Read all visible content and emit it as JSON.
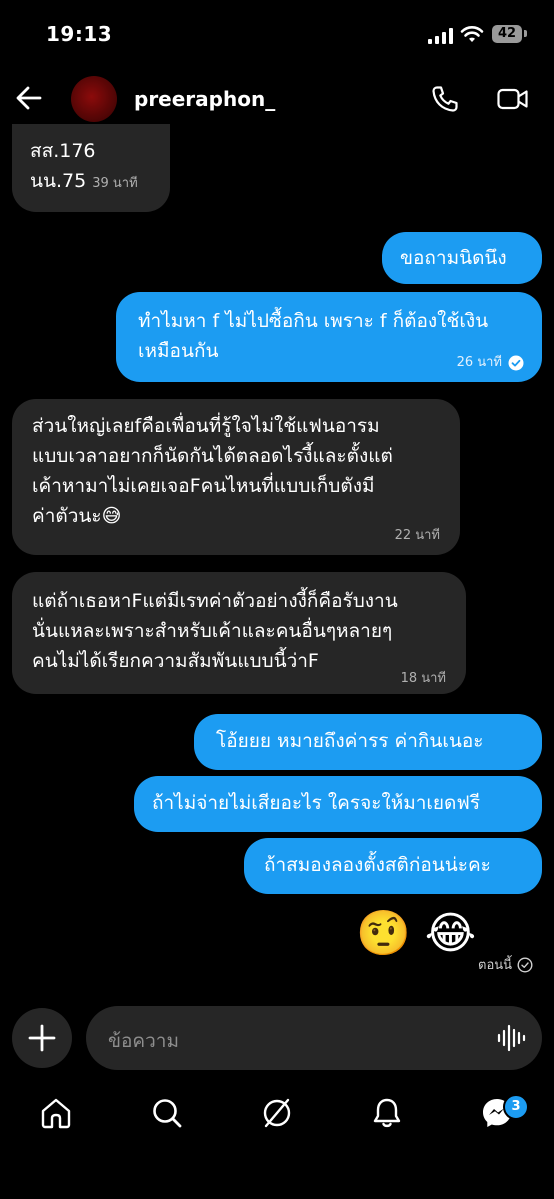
{
  "status_bar": {
    "time": "19:13",
    "battery": "42"
  },
  "header": {
    "username": "preeraphon_"
  },
  "messages": {
    "m0": {
      "line1": "สส.176",
      "line2": "นน.75",
      "time": "39 นาที"
    },
    "m1": {
      "text": "ขอถามนิดนึง"
    },
    "m2": {
      "line1": "ทำไมหา f ไม่ไปซื้อกิน เพราะ f ก็ต้องใช้เงิน",
      "line2": "เหมือนกัน",
      "time": "26 นาที"
    },
    "m3": {
      "line1": "ส่วนใหญ่เลยfคือเพื่อนที่รู้ใจไม่ใช้แฟนอารม",
      "line2": "แบบเวลาอยากก็นัดกันได้ตลอดไรงี้และตั้งแต่",
      "line3": "เค้าหามาไม่เคยเจอFคนไหนที่แบบเก็บตังมี",
      "line4": "ค่าตัวนะ😅",
      "time": "22 นาที"
    },
    "m4": {
      "line1": "แต่ถ้าเธอหาFแต่มีเรทค่าตัวอย่างงี้ก็คือรับงาน",
      "line2": "นั่นแหละเพราะสำหรับเค้าและคนอื่นๆหลายๆ",
      "line3": "คนไม่ได้เรียกความสัมพันแบบนี้ว่าF",
      "time": "18 นาที"
    },
    "m5": {
      "text": "โอ้ยยย  หมายถึงค่ารร ค่ากินเนอะ"
    },
    "m6": {
      "text": "ถ้าไม่จ่ายไม่เสียอะไร ใครจะให้มาเยดฟรี"
    },
    "m7": {
      "text": "ถ้าสมองลองตั้งสติก่อนน่ะคะ"
    },
    "m8": {
      "emoji": "🤨 😂",
      "status": "ตอนนี้"
    }
  },
  "composer": {
    "placeholder": "ข้อความ"
  },
  "nav": {
    "badge": "3"
  },
  "colors": {
    "outgoing": "#1c9cf2",
    "incoming": "#262626",
    "background": "#000000"
  },
  "icons": [
    "back-arrow-icon",
    "phone-icon",
    "video-icon",
    "plus-icon",
    "voice-wave-icon",
    "home-icon",
    "search-icon",
    "explore-icon",
    "bell-icon",
    "messenger-icon",
    "check-circle-icon"
  ]
}
